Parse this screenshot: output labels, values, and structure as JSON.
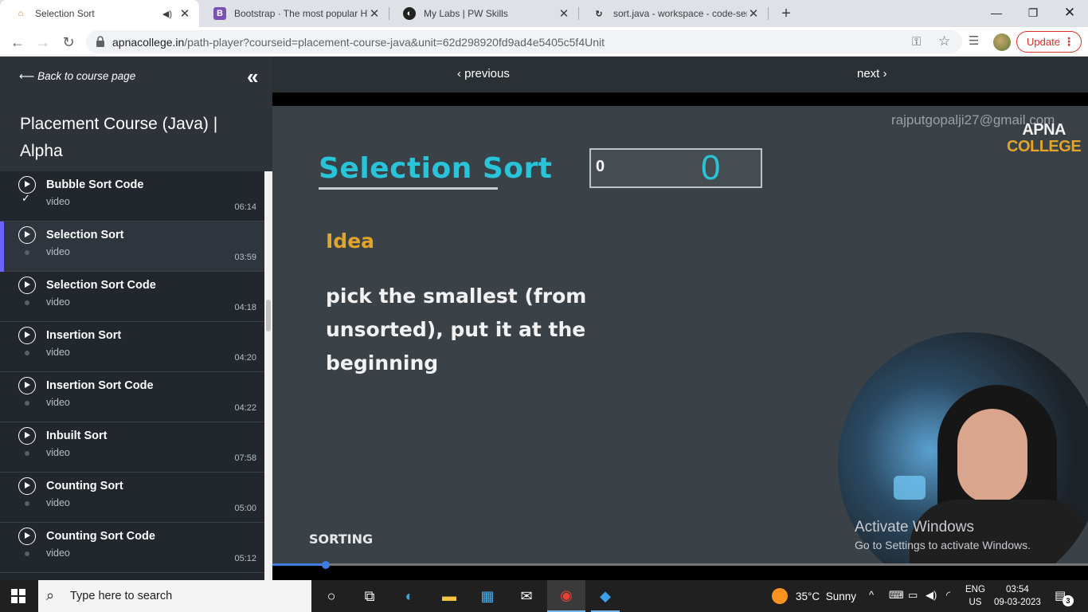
{
  "browser": {
    "tabs": [
      {
        "title": "Selection Sort",
        "favicon": "apna-college-icon",
        "active": true,
        "audio": true
      },
      {
        "title": "Bootstrap · The most popular HTML",
        "favicon": "bootstrap-icon",
        "active": false
      },
      {
        "title": "My Labs | PW Skills",
        "favicon": "pw-skills-icon",
        "active": false
      },
      {
        "title": "sort.java - workspace - code-server",
        "favicon": "code-server-icon",
        "active": false
      }
    ],
    "url_host": "apnacollege.in",
    "url_path": "/path-player?courseid=placement-course-java&unit=62d298920fd9ad4e5405c5f4Unit",
    "update_label": "Update"
  },
  "sidebar": {
    "back_label": "Back to course page",
    "course_title": "Placement Course (Java) | Alpha",
    "lessons": [
      {
        "name": "Bubble Sort Code",
        "type": "video",
        "duration": "06:14",
        "completed": true,
        "active": false
      },
      {
        "name": "Selection Sort",
        "type": "video",
        "duration": "03:59",
        "completed": false,
        "active": true
      },
      {
        "name": "Selection Sort Code",
        "type": "video",
        "duration": "04:18",
        "completed": false,
        "active": false
      },
      {
        "name": "Insertion Sort",
        "type": "video",
        "duration": "04:20",
        "completed": false,
        "active": false
      },
      {
        "name": "Insertion Sort Code",
        "type": "video",
        "duration": "04:22",
        "completed": false,
        "active": false
      },
      {
        "name": "Inbuilt Sort",
        "type": "video",
        "duration": "07:58",
        "completed": false,
        "active": false
      },
      {
        "name": "Counting Sort",
        "type": "video",
        "duration": "05:00",
        "completed": false,
        "active": false
      },
      {
        "name": "Counting Sort Code",
        "type": "video",
        "duration": "05:12",
        "completed": false,
        "active": false
      }
    ]
  },
  "nav": {
    "previous_label": "previous",
    "next_label": "next"
  },
  "video": {
    "slide_title": "Selection Sort",
    "counter_small": "0",
    "counter_big": "0",
    "idea_heading": "Idea",
    "idea_text": "pick the smallest (from unsorted), put it at the beginning",
    "footer_label": "SORTING",
    "watermark_email": "rajputgopalji27@gmail.com",
    "logo_line1": "APNA",
    "logo_line2": "COLLEGE",
    "activate_title": "Activate Windows",
    "activate_sub": "Go to Settings to activate Windows.",
    "progress_fraction": 0.065
  },
  "taskbar": {
    "search_placeholder": "Type here to search",
    "weather_temp": "35°C",
    "weather_text": "Sunny",
    "lang_line1": "ENG",
    "lang_line2": "US",
    "time": "03:54",
    "date": "09-03-2023",
    "notification_count": "3"
  },
  "colors": {
    "accent": "#6c63ff",
    "slide_title": "#29c4d9",
    "idea": "#e0a52a",
    "update": "#d93025"
  }
}
